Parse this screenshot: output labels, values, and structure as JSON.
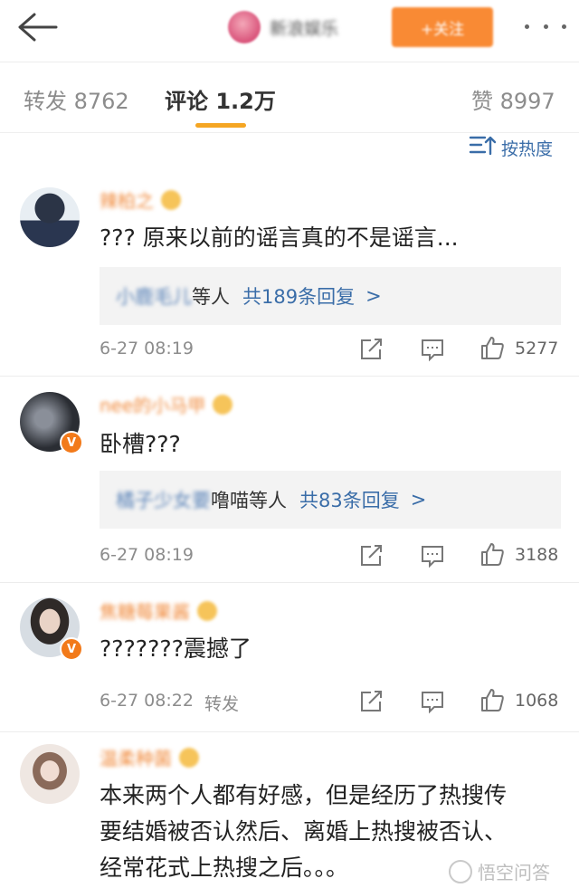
{
  "header": {
    "account_name": "新浪娱乐",
    "follow_label": "+关注"
  },
  "tabs": [
    {
      "label": "转发 8762"
    },
    {
      "label": "评论 1.2万"
    },
    {
      "label": "赞 8997"
    }
  ],
  "sort_label": "按热度",
  "comments": [
    {
      "username": "辣柏之",
      "text": "??? 原来以前的谣言真的不是谣言...",
      "reply": {
        "names": "小鹿毛儿",
        "suffix": "等人",
        "count_label": "共189条回复",
        "chevron": ">"
      },
      "time": "6-27 08:19",
      "likes": "5277"
    },
    {
      "username": "nee的小马甲",
      "text": "卧槽???",
      "reply": {
        "names": "橘子少女要",
        "names_clear": "噜喵",
        "suffix": "等人",
        "count_label": "共83条回复",
        "chevron": ">"
      },
      "time": "6-27 08:19",
      "likes": "3188"
    },
    {
      "username": "焦糖莓果酱",
      "text": "???????震撼了",
      "time": "6-27 08:22",
      "extra": "转发",
      "likes": "1068"
    },
    {
      "username": "温柔种菌",
      "lines": [
        "本来两个人都有好感，但是经历了热搜传",
        "要结婚被否认然后、离婚上热搜被否认、",
        "经常花式上热搜之后。。。"
      ]
    }
  ],
  "watermark": "悟空问答",
  "colors": {
    "accent_orange": "#f98a34",
    "link_blue": "#3a6da8",
    "tab_underline": "#f5a623"
  }
}
